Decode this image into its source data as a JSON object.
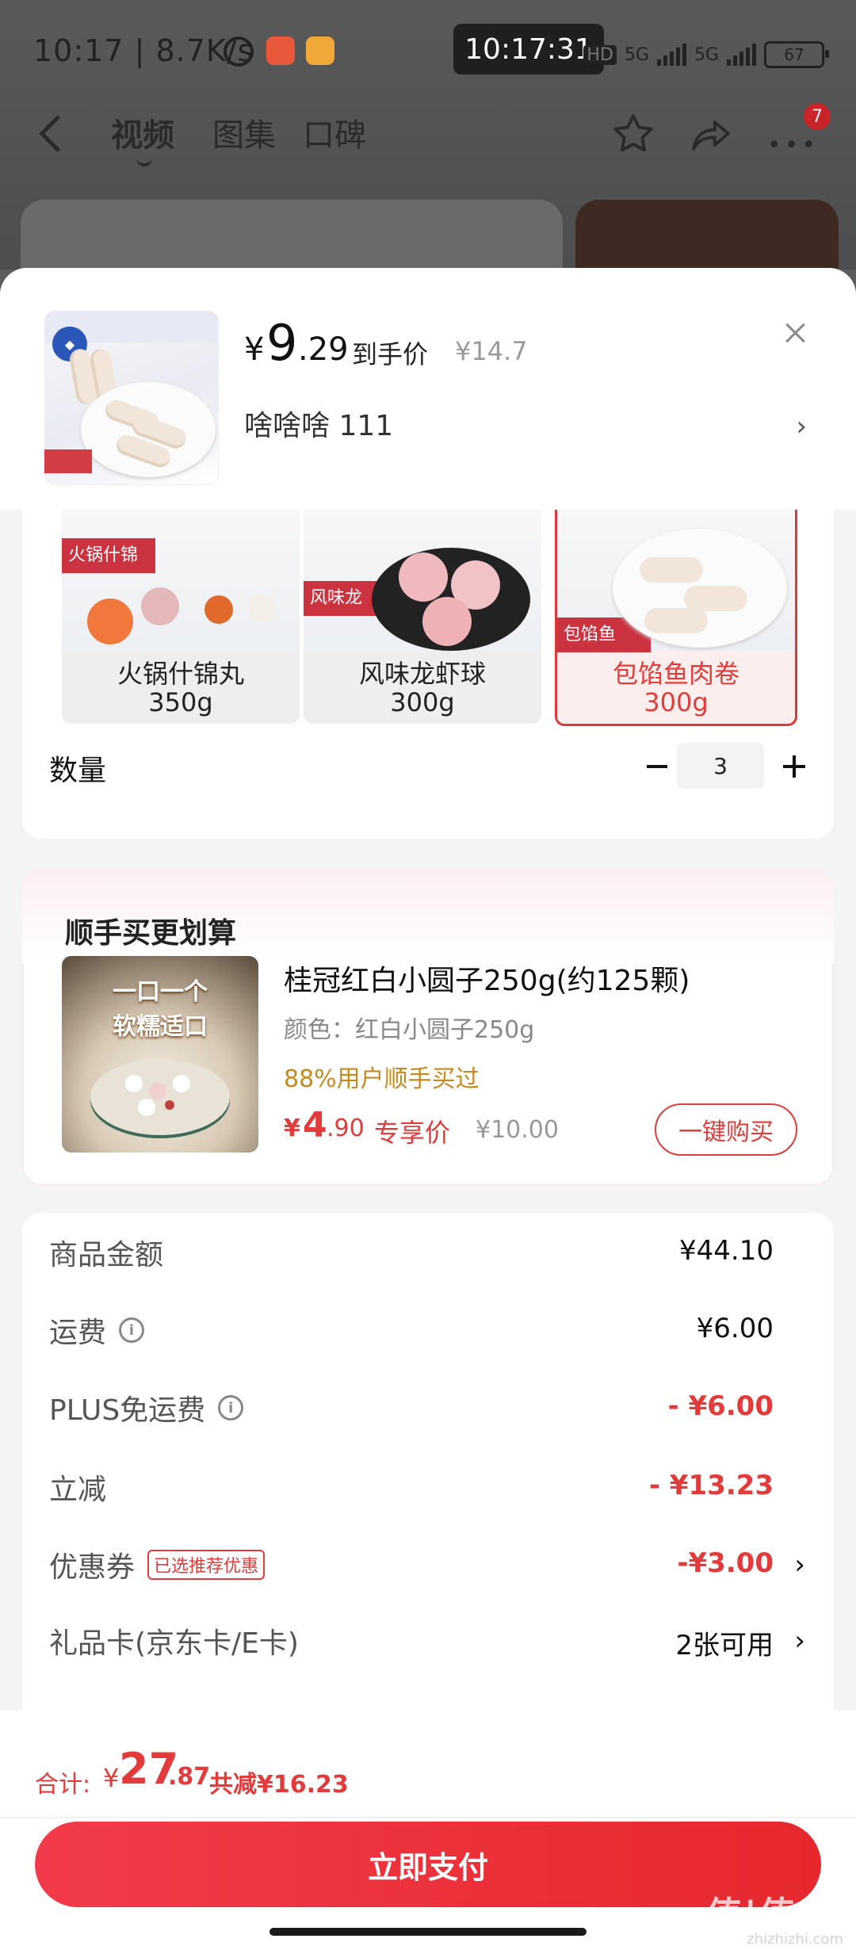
{
  "status_bar": {
    "left_text": "10:17 | 8.7K/s",
    "timer": "10:17:31",
    "net_hd": "HD",
    "net_5g_a": "5G",
    "net_5g_b": "5G",
    "battery": "67"
  },
  "nav": {
    "tabs": [
      "视频",
      "图集",
      "口碑"
    ],
    "cart_badge": "7"
  },
  "product": {
    "price_symbol": "¥",
    "price_int": "9",
    "price_dec": ".29",
    "price_tag": "到手价",
    "original_price": "¥14.7",
    "selected_spec": "啥啥啥  111"
  },
  "variants": [
    {
      "name": "火锅什锦丸",
      "weight": "350g",
      "selected": false
    },
    {
      "name": "风味龙虾球",
      "weight": "300g",
      "selected": false
    },
    {
      "name": "包馅鱼肉卷",
      "weight": "300g",
      "selected": true
    }
  ],
  "variant_image_text": {
    "v1": "火锅什锦",
    "v2": "风味龙",
    "v3": "包馅鱼"
  },
  "quantity": {
    "label": "数量",
    "value": "3"
  },
  "addon": {
    "section_title": "顺手买更划算",
    "image_text": "一口一个\n软糯适口",
    "name": "桂冠红白小圆子250g(约125颗)",
    "color": "颜色：红白小圆子250g",
    "social": "88%用户顺手买过",
    "price_symbol": "¥",
    "price_int": "4",
    "price_dec": ".90",
    "price_tag": "专享价",
    "original_price": "¥10.00",
    "button": "一键购买"
  },
  "summary": {
    "goods_label": "商品金额",
    "goods_value": "¥44.10",
    "shipping_label": "运费",
    "shipping_value": "¥6.00",
    "plus_label": "PLUS免运费",
    "plus_value": "- ¥6.00",
    "instant_label": "立减",
    "instant_value": "- ¥13.23",
    "coupon_label": "优惠券",
    "coupon_badge": "已选推荐优惠",
    "coupon_value": "-¥3.00",
    "giftcard_label": "礼品卡(京东卡/E卡)",
    "giftcard_value": "2张可用"
  },
  "total": {
    "label": "合计:",
    "symbol": "¥",
    "int": "27",
    "dec": ".87",
    "saved": "共减¥16.23"
  },
  "pay_button": "立即支付",
  "watermark": {
    "main": "值|值|值",
    "sub": "zhizhizhi.com"
  },
  "colors": {
    "accent_red": "#e23b3b",
    "coupon_orange": "#c48a1e",
    "pay_gradient_start": "#f23b4a",
    "pay_gradient_end": "#e6282e"
  }
}
